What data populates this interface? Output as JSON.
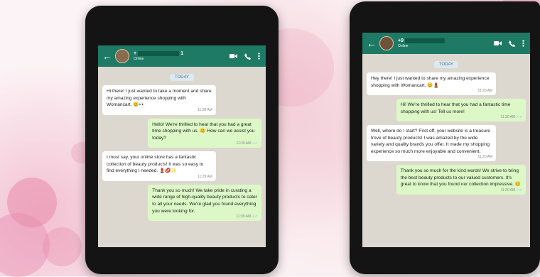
{
  "left_phone": {
    "header": {
      "name_prefix": "+",
      "name_suffix": "1",
      "status": "Online"
    },
    "day_label": "TODAY",
    "messages": [
      {
        "dir": "in",
        "text": "Hi there! I just wanted to take a moment and share my amazing experience shopping with Womancart.",
        "emoji": "😊👀",
        "time": "11:28 AM"
      },
      {
        "dir": "out",
        "text": "Hello! We're thrilled to hear that you had a great time shopping with us.",
        "emoji": "😊",
        "text2": "How can we assist you today?",
        "time": "11:30 AM"
      },
      {
        "dir": "in",
        "text": "I must say, your online store has a fantastic collection of beauty products! It was so easy to find everything I needed.",
        "emoji": "💄💋✨",
        "time": "11:29 AM"
      },
      {
        "dir": "out",
        "text": "Thank you so much! We take pride in curating a wide range of high-quality beauty products to cater to all your needs. We're glad you found everything you were looking for.",
        "time": "11:30 AM"
      }
    ]
  },
  "right_phone": {
    "header": {
      "name_prefix": "+9",
      "status": "Online"
    },
    "day_label": "TODAY",
    "messages": [
      {
        "dir": "in",
        "text": "Hey there! I just wanted to share my amazing experience shopping with Womancart.",
        "emoji": "😊💄",
        "time": "11:20 AM"
      },
      {
        "dir": "out",
        "text": "Hi! We're thrilled to hear that you had a fantastic time shopping with us! Tell us more!",
        "time": "11:30 AM"
      },
      {
        "dir": "in",
        "text": "Well, where do I start? First off, your website is a treasure trove of beauty products! I was amazed by the wide variety and quality brands you offer. It made my shopping experience so much more enjoyable and convenient.",
        "time": "11:20 AM"
      },
      {
        "dir": "out",
        "text": "Thank you so much for the kind words! We strive to bring the best beauty products to our valued customers. It's great to know that you found our collection impressive.",
        "emoji": "😊",
        "time": "11:30 AM"
      }
    ]
  },
  "colors": {
    "header": "#1e7a64",
    "chat_bg": "#ddd8cf",
    "incoming": "#ffffff",
    "outgoing": "#dcf8c6"
  },
  "icons": [
    "back-arrow-icon",
    "video-call-icon",
    "phone-call-icon",
    "more-options-icon",
    "read-receipt-icon"
  ]
}
